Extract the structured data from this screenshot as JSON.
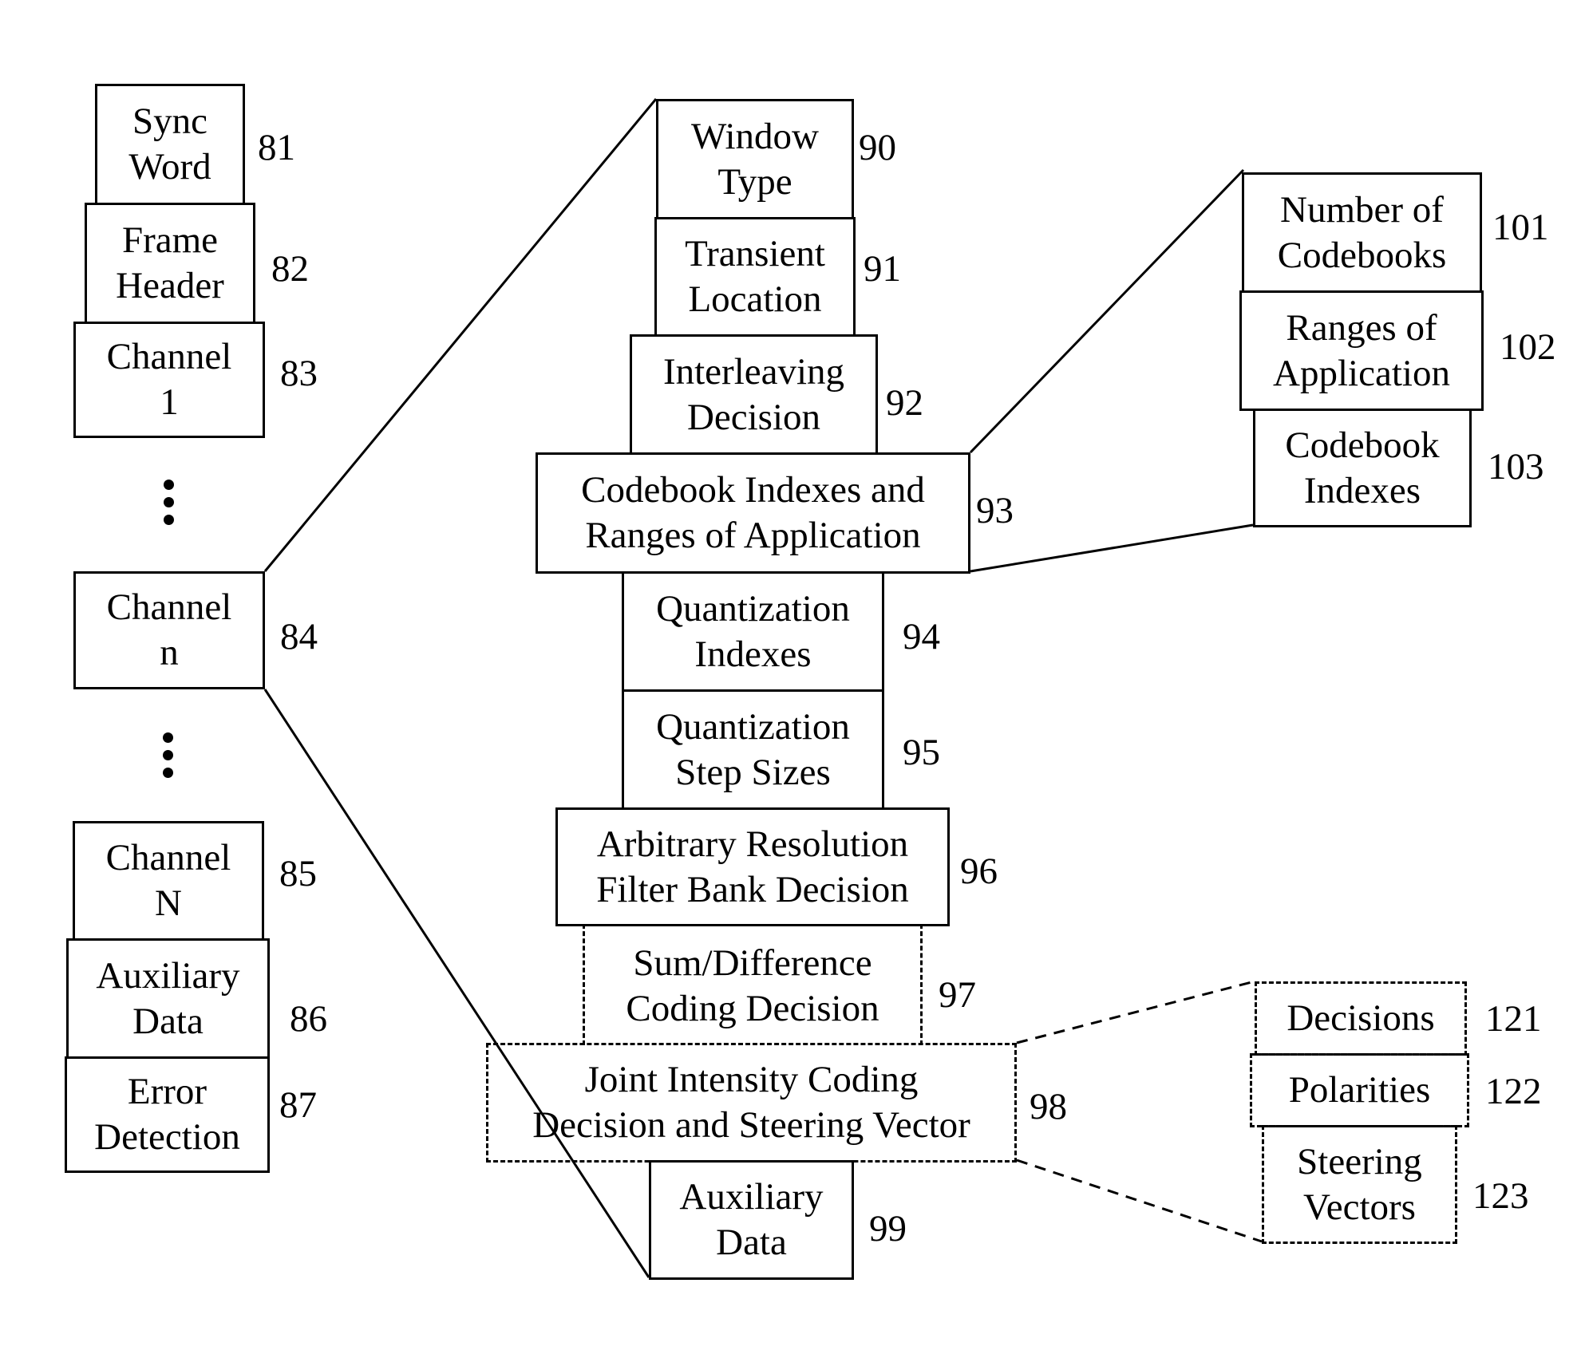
{
  "figure": {
    "frame_fields": [
      {
        "id": "81",
        "label": "Sync\nWord"
      },
      {
        "id": "82",
        "label": "Frame\nHeader"
      },
      {
        "id": "83",
        "label": "Channel\n1"
      },
      {
        "id": "84",
        "label": "Channel\nn"
      },
      {
        "id": "85",
        "label": "Channel\nN"
      },
      {
        "id": "86",
        "label": "Auxiliary\nData"
      },
      {
        "id": "87",
        "label": "Error\nDetection"
      }
    ],
    "channel_fields": [
      {
        "id": "90",
        "label": "Window\nType",
        "style": "solid"
      },
      {
        "id": "91",
        "label": "Transient\nLocation",
        "style": "solid"
      },
      {
        "id": "92",
        "label": "Interleaving\nDecision",
        "style": "solid"
      },
      {
        "id": "93",
        "label": "Codebook Indexes and\nRanges of Application",
        "style": "solid"
      },
      {
        "id": "94",
        "label": "Quantization\nIndexes",
        "style": "solid"
      },
      {
        "id": "95",
        "label": "Quantization\nStep Sizes",
        "style": "solid"
      },
      {
        "id": "96",
        "label": "Arbitrary Resolution\nFilter Bank Decision",
        "style": "solid"
      },
      {
        "id": "97",
        "label": "Sum/Difference\nCoding Decision",
        "style": "dashed"
      },
      {
        "id": "98",
        "label": "Joint Intensity Coding\nDecision and Steering Vector",
        "style": "dashed"
      },
      {
        "id": "99",
        "label": "Auxiliary\nData",
        "style": "solid"
      }
    ],
    "codebook_fields": [
      {
        "id": "101",
        "label": "Number of\nCodebooks"
      },
      {
        "id": "102",
        "label": "Ranges of\nApplication"
      },
      {
        "id": "103",
        "label": "Codebook\nIndexes"
      }
    ],
    "joint_intensity_fields": [
      {
        "id": "121",
        "label": "Decisions"
      },
      {
        "id": "122",
        "label": "Polarities"
      },
      {
        "id": "123",
        "label": "Steering\nVectors"
      }
    ],
    "expansions": [
      {
        "from": "84",
        "to": "channel_fields",
        "style": "solid"
      },
      {
        "from": "93",
        "to": "codebook_fields",
        "style": "solid"
      },
      {
        "from": "98",
        "to": "joint_intensity_fields",
        "style": "dashed"
      }
    ]
  }
}
